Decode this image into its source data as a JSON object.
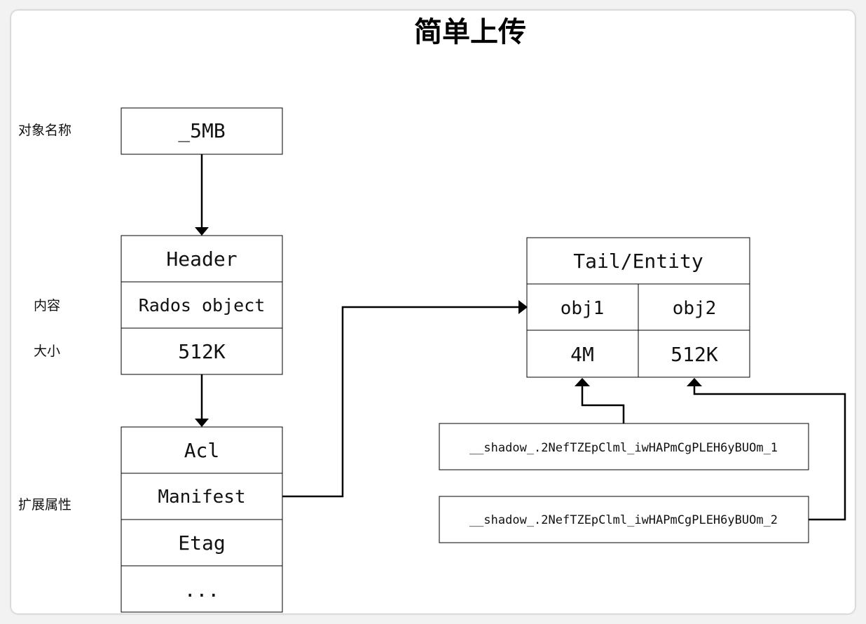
{
  "title": "简单上传",
  "side_labels": {
    "object_name": "对象名称",
    "content": "内容",
    "size": "大小",
    "extended_attributes": "扩展属性"
  },
  "object_box": {
    "name": "_5MB"
  },
  "header_box": {
    "header": "Header",
    "content": "Rados object",
    "size": "512K"
  },
  "xattr_box": {
    "items": [
      "Acl",
      "Manifest",
      "Etag",
      "..."
    ]
  },
  "tail_box": {
    "title": "Tail/Entity",
    "obj1_name": "obj1",
    "obj2_name": "obj2",
    "obj1_size": "4M",
    "obj2_size": "512K"
  },
  "shadow_objects": [
    "__shadow_.2NefTZEpClml_iwHAPmCgPLEH6yBUOm_1",
    "__shadow_.2NefTZEpClml_iwHAPmCgPLEH6yBUOm_2"
  ]
}
